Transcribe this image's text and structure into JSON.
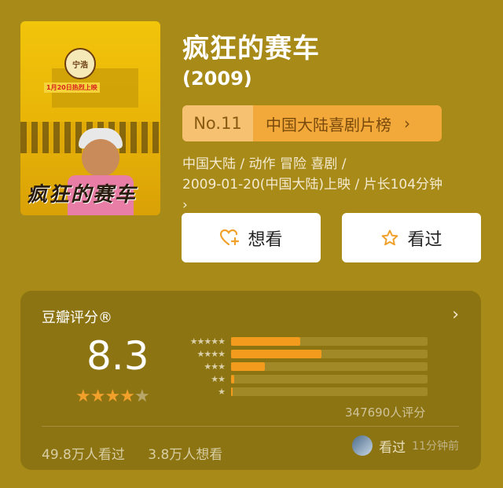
{
  "movie": {
    "title": "疯狂的赛车",
    "year": "(2009)",
    "poster": {
      "badge_text": "宁浩",
      "date_text": "1月20日热烈上映",
      "title_text": "疯狂的赛车"
    },
    "rank": {
      "number": "No.11",
      "list_name": "中国大陆喜剧片榜",
      "chevron": "›"
    },
    "meta_line1": "中国大陆 / 动作 冒险 喜剧 /",
    "meta_line2": "2009-01-20(中国大陆)上映 / 片长104分钟",
    "meta_chevron": "›",
    "buttons": {
      "want_label": "想看",
      "want_icon": "heart-plus-icon",
      "seen_label": "看过",
      "seen_icon": "star-outline-icon"
    }
  },
  "rating": {
    "label": "豆瓣评分®",
    "more_chevron": "›",
    "score": "8.3",
    "stars_filled": 4,
    "stars_total": 5,
    "distribution": [
      {
        "stars": "★★★★★",
        "fraction": 0.35
      },
      {
        "stars": "★★★★",
        "fraction": 0.46
      },
      {
        "stars": "★★★",
        "fraction": 0.17
      },
      {
        "stars": "★★",
        "fraction": 0.015
      },
      {
        "stars": "★",
        "fraction": 0.005
      }
    ],
    "count_text": "347690人评分",
    "seen_count": "49.8万人看过",
    "want_count": "3.8万人想看",
    "recent_status": "看过",
    "recent_time": "11分钟前"
  },
  "colors": {
    "background": "#a88a18",
    "accent_orange": "#f29b1d",
    "rank_tag": "#f2a93a"
  }
}
